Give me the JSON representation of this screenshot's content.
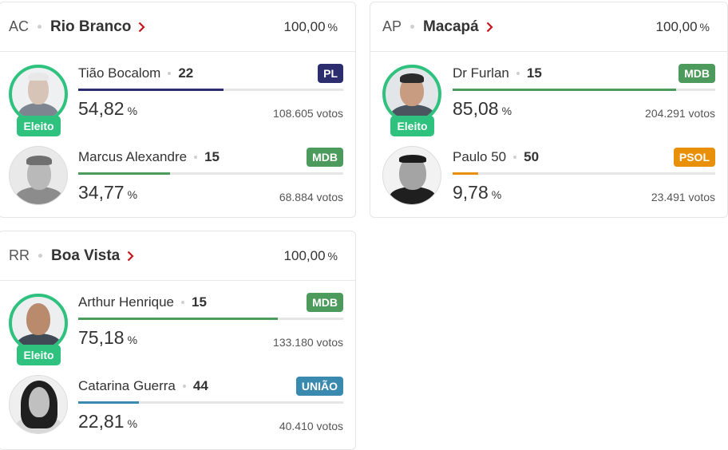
{
  "cards": [
    {
      "uf": "AC",
      "city": "Rio Branco",
      "total_value": "100,00",
      "total_unit": "%",
      "candidates": [
        {
          "name": "Tião Bocalom",
          "number": "22",
          "party": "PL",
          "party_color": "#2b2d6e",
          "pct": "54,82",
          "pct_unit": "%",
          "votes": "108.605 votos",
          "share": 0.5482,
          "bar_color": "#2b2d6e",
          "elected": true,
          "elected_label": "Eleito"
        },
        {
          "name": "Marcus Alexandre",
          "number": "15",
          "party": "MDB",
          "party_color": "#4c9a5c",
          "pct": "34,77",
          "pct_unit": "%",
          "votes": "68.884 votos",
          "share": 0.3477,
          "bar_color": "#4c9a5c",
          "elected": false
        }
      ]
    },
    {
      "uf": "AP",
      "city": "Macapá",
      "total_value": "100,00",
      "total_unit": "%",
      "candidates": [
        {
          "name": "Dr Furlan",
          "number": "15",
          "party": "MDB",
          "party_color": "#4c9a5c",
          "pct": "85,08",
          "pct_unit": "%",
          "votes": "204.291 votos",
          "share": 0.8508,
          "bar_color": "#4c9a5c",
          "elected": true,
          "elected_label": "Eleito"
        },
        {
          "name": "Paulo 50",
          "number": "50",
          "party": "PSOL",
          "party_color": "#e8900a",
          "pct": "9,78",
          "pct_unit": "%",
          "votes": "23.491 votos",
          "share": 0.0978,
          "bar_color": "#e8900a",
          "elected": false
        }
      ]
    },
    {
      "uf": "RR",
      "city": "Boa Vista",
      "total_value": "100,00",
      "total_unit": "%",
      "candidates": [
        {
          "name": "Arthur Henrique",
          "number": "15",
          "party": "MDB",
          "party_color": "#4c9a5c",
          "pct": "75,18",
          "pct_unit": "%",
          "votes": "133.180 votos",
          "share": 0.7518,
          "bar_color": "#4c9a5c",
          "elected": true,
          "elected_label": "Eleito"
        },
        {
          "name": "Catarina Guerra",
          "number": "44",
          "party": "UNIÃO",
          "party_color": "#3a8ab0",
          "pct": "22,81",
          "pct_unit": "%",
          "votes": "40.410 votos",
          "share": 0.2281,
          "bar_color": "#3a8ab0",
          "elected": false
        }
      ]
    }
  ],
  "colors": {
    "elected": "#2ec27e",
    "chevron": "#c8161d"
  },
  "icons": {
    "chevron": "chevron-right-icon",
    "photo": "candidate-photo"
  }
}
